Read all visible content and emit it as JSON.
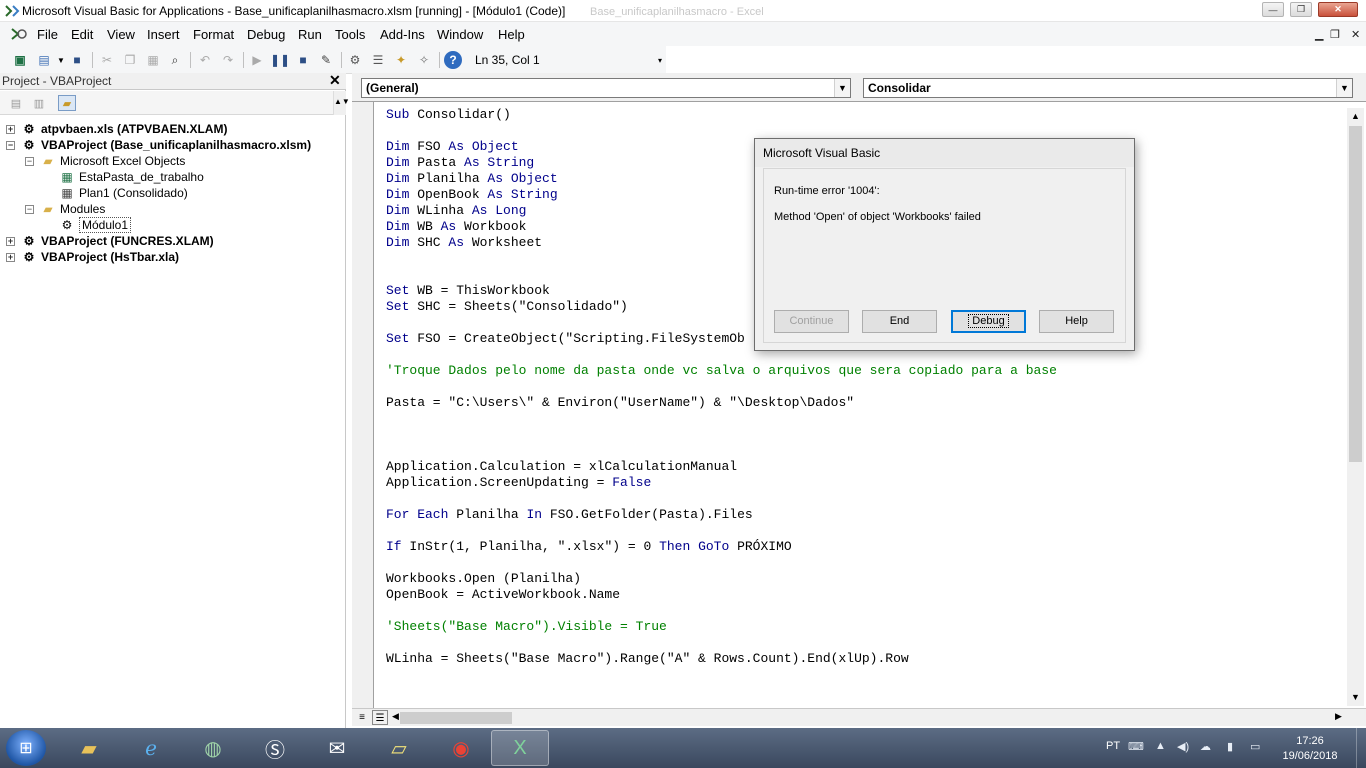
{
  "window": {
    "title": "Microsoft Visual Basic for Applications - Base_unificaplanilhasmacro.xlsm [running] - [Módulo1 (Code)]",
    "ghost_title": "Base_unificaplanilhasmacro - Excel",
    "controls": {
      "minimize": "—",
      "maximize": "❐",
      "close": "✕"
    }
  },
  "menu": {
    "items": [
      "File",
      "Edit",
      "View",
      "Insert",
      "Format",
      "Debug",
      "Run",
      "Tools",
      "Add-Ins",
      "Window",
      "Help"
    ],
    "mdi_controls": {
      "minimize": "▁",
      "restore": "❐",
      "close": "✕"
    }
  },
  "toolbar": {
    "status": "Ln 35, Col 1"
  },
  "project": {
    "header": "Project - VBAProject",
    "close": "✕",
    "tree": [
      {
        "label": "atpvbaen.xls (ATPVBAEN.XLAM)",
        "expander": "+"
      },
      {
        "label": "VBAProject (Base_unificaplanilhasmacro.xlsm)",
        "expander": "−"
      },
      {
        "label": "Microsoft Excel Objects",
        "expander": "−"
      },
      {
        "label": "EstaPasta_de_trabalho"
      },
      {
        "label": "Plan1 (Consolidado)"
      },
      {
        "label": "Modules",
        "expander": "−"
      },
      {
        "label": "Módulo1"
      },
      {
        "label": "VBAProject (FUNCRES.XLAM)",
        "expander": "+"
      },
      {
        "label": "VBAProject (HsTbar.xla)",
        "expander": "+"
      }
    ]
  },
  "code": {
    "object_combo": "(General)",
    "proc_combo": "Consolidar",
    "lines": [
      [
        {
          "t": "Sub",
          "k": "kw"
        },
        {
          "t": " Consolidar()"
        }
      ],
      [
        {
          "t": "Dim",
          "k": "kw"
        },
        {
          "t": " FSO "
        },
        {
          "t": "As Object",
          "k": "kw"
        }
      ],
      [
        {
          "t": "Dim",
          "k": "kw"
        },
        {
          "t": " Pasta "
        },
        {
          "t": "As String",
          "k": "kw"
        }
      ],
      [
        {
          "t": "Dim",
          "k": "kw"
        },
        {
          "t": " Planilha "
        },
        {
          "t": "As Object",
          "k": "kw"
        }
      ],
      [
        {
          "t": "Dim",
          "k": "kw"
        },
        {
          "t": " OpenBook "
        },
        {
          "t": "As String",
          "k": "kw"
        }
      ],
      [
        {
          "t": "Dim",
          "k": "kw"
        },
        {
          "t": " WLinha "
        },
        {
          "t": "As Long",
          "k": "kw"
        }
      ],
      [
        {
          "t": "Dim",
          "k": "kw"
        },
        {
          "t": " WB "
        },
        {
          "t": "As",
          "k": "kw"
        },
        {
          "t": " Workbook"
        }
      ],
      [
        {
          "t": "Dim",
          "k": "kw"
        },
        {
          "t": " SHC "
        },
        {
          "t": "As",
          "k": "kw"
        },
        {
          "t": " Worksheet"
        }
      ],
      [
        {
          "t": "Set",
          "k": "kw"
        },
        {
          "t": " WB = ThisWorkbook"
        }
      ],
      [
        {
          "t": "Set",
          "k": "kw"
        },
        {
          "t": " SHC = Sheets(\"Consolidado\")"
        }
      ],
      [
        {
          "t": "Set",
          "k": "kw"
        },
        {
          "t": " FSO = CreateObject(\"Scripting.FileSystemOb"
        }
      ],
      [
        {
          "t": "'Troque Dados pelo nome da pasta onde vc salva o arquivos que sera copiado para a base",
          "k": "cm"
        }
      ],
      [
        {
          "t": "Pasta = \"C:\\Users\\\" & Environ(\"UserName\") & \"\\Desktop\\Dados\""
        }
      ],
      [
        {
          "t": "Application.Calculation = xlCalculationManual"
        }
      ],
      [
        {
          "t": "Application.ScreenUpdating = "
        },
        {
          "t": "False",
          "k": "kw"
        }
      ],
      [
        {
          "t": "For Each",
          "k": "kw"
        },
        {
          "t": " Planilha "
        },
        {
          "t": "In",
          "k": "kw"
        },
        {
          "t": " FSO.GetFolder(Pasta).Files"
        }
      ],
      [
        {
          "t": "If",
          "k": "kw"
        },
        {
          "t": " InStr(1, Planilha, \".xlsx\") = 0 "
        },
        {
          "t": "Then GoTo",
          "k": "kw"
        },
        {
          "t": " PRÓXIMO"
        }
      ],
      [
        {
          "t": "Workbooks.Open (Planilha)"
        }
      ],
      [
        {
          "t": "OpenBook = ActiveWorkbook.Name"
        }
      ],
      [
        {
          "t": "'Sheets(\"Base Macro\").Visible = True",
          "k": "cm"
        }
      ],
      [
        {
          "t": "WLinha = Sheets(\"Base Macro\").Range(\"A\" & Rows.Count).End(xlUp).Row"
        }
      ]
    ]
  },
  "dialog": {
    "title": "Microsoft Visual Basic",
    "message1": "Run-time error '1004':",
    "message2": "Method 'Open' of object 'Workbooks' failed",
    "buttons": {
      "continue": "Continue",
      "end": "End",
      "debug": "Debug",
      "help": "Help"
    }
  },
  "taskbar": {
    "language": "PT",
    "time": "17:26",
    "date": "19/06/2018"
  },
  "colors": {
    "keyword": "#00008b",
    "comment": "#008000",
    "taskbar": "#4a5a72"
  }
}
